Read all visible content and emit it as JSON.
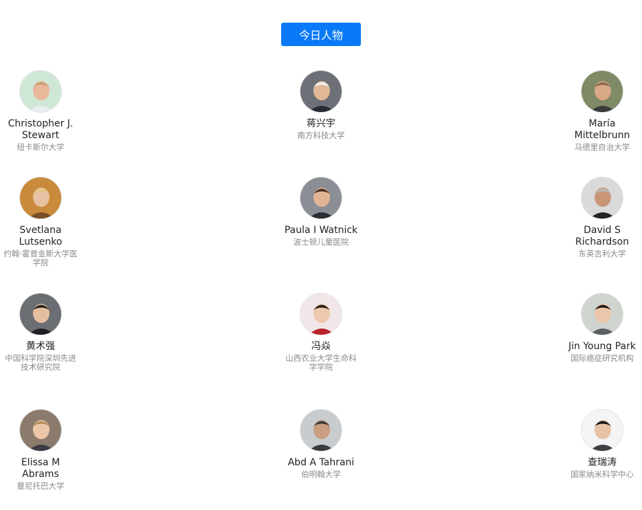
{
  "header": {
    "title": "今日人物"
  },
  "people": [
    {
      "name": "Christopher J. Stewart",
      "org": "纽卡斯尔大学",
      "bg": "#cfe7d6",
      "skin": "#e9b89b",
      "hair": "#c9a071",
      "shirt": "#e9eef2"
    },
    {
      "name": "蒋兴宇",
      "org": "南方科技大学",
      "bg": "#6d7077",
      "skin": "#e0b896",
      "hair": "#f1f1f1",
      "shirt": "#2a2c33"
    },
    {
      "name": "María Mittelbrunn",
      "org": "马德里自治大学",
      "bg": "#7f8a66",
      "skin": "#d9a887",
      "hair": "#8b6a4b",
      "shirt": "#3a3a3a"
    },
    {
      "name": "Svetlana Lutsenko",
      "org": "约翰·霍普金斯大学医学院",
      "bg": "#c98a3b",
      "skin": "#e7c2a2",
      "hair": "#e3c783",
      "shirt": "#7a4e2a"
    },
    {
      "name": "Paula I Watnick",
      "org": "波士顿儿童医院",
      "bg": "#8b8e94",
      "skin": "#e2b596",
      "hair": "#4a342a",
      "shirt": "#2c2d33"
    },
    {
      "name": "David S Richardson",
      "org": "东英吉利大学",
      "bg": "#dadada",
      "skin": "#c99577",
      "hair": "#b9b9b9",
      "shirt": "#252525"
    },
    {
      "name": "黄术强",
      "org": "中国科学院深圳先进技术研究院",
      "bg": "#6b6e73",
      "skin": "#e5bf9f",
      "hair": "#1f1f1f",
      "shirt": "#1d1f25"
    },
    {
      "name": "冯焱",
      "org": "山西农业大学生命科学学院",
      "bg": "#f2e7e8",
      "skin": "#edc8ae",
      "hair": "#2a1e1a",
      "shirt": "#b8232b"
    },
    {
      "name": "Jin Young Park",
      "org": "国际癌症研究机构",
      "bg": "#cfd4cf",
      "skin": "#ecc6aa",
      "hair": "#1e1a18",
      "shirt": "#5a5e64"
    },
    {
      "name": "Elissa M Abrams",
      "org": "曼尼托巴大学",
      "bg": "#8a7b6d",
      "skin": "#edc6a8",
      "hair": "#b68c5a",
      "shirt": "#3b3b44"
    },
    {
      "name": "Abd A Tahrani",
      "org": "伯明翰大学",
      "bg": "#c9ccce",
      "skin": "#c99d7f",
      "hair": "#3a3a3a",
      "shirt": "#3a3b40"
    },
    {
      "name": "查瑞涛",
      "org": "国家纳米科学中心",
      "bg": "#f4f4f4",
      "skin": "#e8c2a4",
      "hair": "#161616",
      "shirt": "#3d3f44"
    }
  ]
}
